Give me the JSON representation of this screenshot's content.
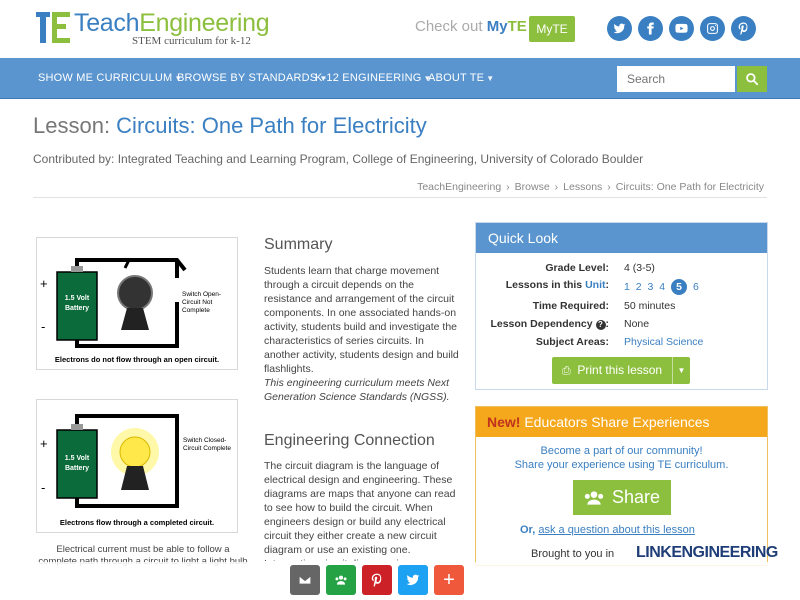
{
  "header": {
    "logo_word1": "Teach",
    "logo_word2": "Engineering",
    "logo_tagline": "STEM curriculum for k-12",
    "checkout_text": "Check out ",
    "checkout_brand_a": "My",
    "checkout_brand_b": "TE",
    "myte_button": "MyTE",
    "social": [
      "twitter-icon",
      "facebook-icon",
      "youtube-icon",
      "instagram-icon",
      "pinterest-icon"
    ],
    "colors": {
      "blue": "#3a7fc1",
      "green": "#8dbf3f",
      "nav": "#5a95cf",
      "orange": "#f6a81c"
    }
  },
  "nav": {
    "items": [
      "SHOW ME CURRICULUM",
      "BROWSE BY STANDARDS",
      "K-12 ENGINEERING",
      "ABOUT TE"
    ],
    "search_placeholder": "Search"
  },
  "page": {
    "title_prefix": "Lesson: ",
    "title": "Circuits: One Path for Electricity",
    "contributed": "Contributed by: Integrated Teaching and Learning Program, College of Engineering, University of Colorado Boulder",
    "breadcrumb": [
      "TeachEngineering",
      "Browse",
      "Lessons",
      "Circuits: One Path for Electricity"
    ]
  },
  "diagrams": {
    "open": {
      "battery": "1.5 Volt Battery",
      "switch": "Switch Open-Circuit Not Complete",
      "caption": "Electrons do not flow through an open circuit."
    },
    "closed": {
      "battery": "1.5 Volt Battery",
      "switch": "Switch Closed-Circuit Complete",
      "caption": "Electrons flow through a completed circuit."
    },
    "figure_caption": "Electrical current must be able to follow a complete path through a circuit to light a light bulb"
  },
  "summary": {
    "heading": "Summary",
    "text": "Students learn that charge movement through a circuit depends on the resistance and arrangement of the circuit components. In one associated hands-on activity, students build and investigate the characteristics of series circuits. In another activity, students design and build flashlights.",
    "ngss": "This engineering curriculum meets Next Generation Science Standards (NGSS)."
  },
  "engineering": {
    "heading": "Engineering Connection",
    "text": "The circuit diagram is the language of electrical design and engineering. These diagrams are maps that anyone can read to see how to build the circuit. When engineers design or build any electrical circuit they either create a new circuit diagram or use an existing one. Interpreting circuit diagrams is an"
  },
  "quick_look": {
    "heading": "Quick Look",
    "grade_label": "Grade Level:",
    "grade_value": "4 (3-5)",
    "lessons_label_a": "Lessons in this ",
    "lessons_label_b": "Unit",
    "lessons_label_c": ":",
    "lessons": [
      "1",
      "2",
      "3",
      "4",
      "5",
      "6"
    ],
    "active_lesson": "5",
    "time_label": "Time Required:",
    "time_value": "50 minutes",
    "dependency_label": "Lesson Dependency",
    "dependency_value": "None",
    "subject_label": "Subject Areas:",
    "subject_value": "Physical Science",
    "print_button": "Print this lesson"
  },
  "educators": {
    "new_label": "New!",
    "heading": " Educators Share Experiences",
    "line1": "Become a part of our community!",
    "line2": "Share your experience using TE curriculum.",
    "share_button": "Share",
    "or_text": "Or, ",
    "ask_link": "ask a question about this lesson",
    "brought": "Brought to you in",
    "partner": "LINKENGINEERING"
  },
  "floating_share": [
    "email-icon",
    "google-classroom-icon",
    "pinterest-icon",
    "twitter-icon",
    "more-icon"
  ]
}
